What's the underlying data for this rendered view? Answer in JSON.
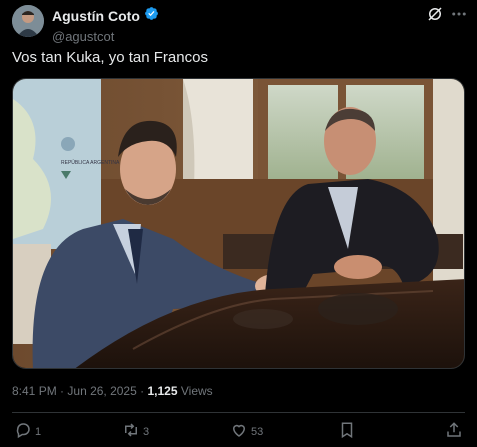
{
  "author": {
    "name": "Agustín Coto",
    "handle": "@agustcot",
    "verified": true
  },
  "tweet": {
    "text": "Vos tan Kuka, yo tan Francos",
    "time": "8:41 PM",
    "date": "Jun 26, 2025",
    "separator": "·",
    "views_count": "1,125",
    "views_label": "Views"
  },
  "actions": {
    "replies": "1",
    "reposts": "3",
    "likes": "53"
  },
  "media": {
    "description": "Two men in suits sitting at a polished wooden table in an office",
    "poster_text": "REPÚBLICA ARGENTINA"
  },
  "icons": {
    "verified": "verified-badge-icon",
    "grok": "grok-icon",
    "more": "more-icon",
    "reply": "reply-icon",
    "repost": "repost-icon",
    "like": "heart-icon",
    "bookmark": "bookmark-icon",
    "share": "share-icon"
  },
  "colors": {
    "background": "#000000",
    "text": "#e7e9ea",
    "secondary": "#71767b",
    "verified": "#1d9bf0",
    "divider": "#2f3336"
  }
}
